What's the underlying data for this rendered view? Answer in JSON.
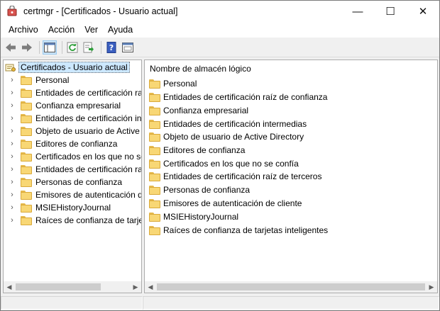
{
  "window": {
    "title": "certmgr - [Certificados - Usuario actual]",
    "minimize": "—",
    "maximize": "☐",
    "close": "✕"
  },
  "menu": [
    "Archivo",
    "Acción",
    "Ver",
    "Ayuda"
  ],
  "toolbar": [
    "back-icon",
    "forward-icon",
    "console-tree-icon",
    "refresh-icon",
    "export-list-icon",
    "help-icon",
    "properties-icon"
  ],
  "tree": {
    "root": "Certificados - Usuario actual",
    "items": [
      "Personal",
      "Entidades de certificación raíz",
      "Confianza empresarial",
      "Entidades de certificación int",
      "Objeto de usuario de Active D",
      "Editores de confianza",
      "Certificados en los que no se",
      "Entidades de certificación raíz",
      "Personas de confianza",
      "Emisores de autenticación de",
      "MSIEHistoryJournal",
      "Raíces de confianza de tarjetas"
    ]
  },
  "list": {
    "column": "Nombre de almacén lógico",
    "items": [
      "Personal",
      "Entidades de certificación raíz de confianza",
      "Confianza empresarial",
      "Entidades de certificación intermedias",
      "Objeto de usuario de Active Directory",
      "Editores de confianza",
      "Certificados en los que no se confía",
      "Entidades de certificación raíz de terceros",
      "Personas de confianza",
      "Emisores de autenticación de cliente",
      "MSIEHistoryJournal",
      "Raíces de confianza de tarjetas inteligentes"
    ]
  },
  "colors": {
    "selection": "#cce8ff",
    "folder": "#f8d775"
  }
}
